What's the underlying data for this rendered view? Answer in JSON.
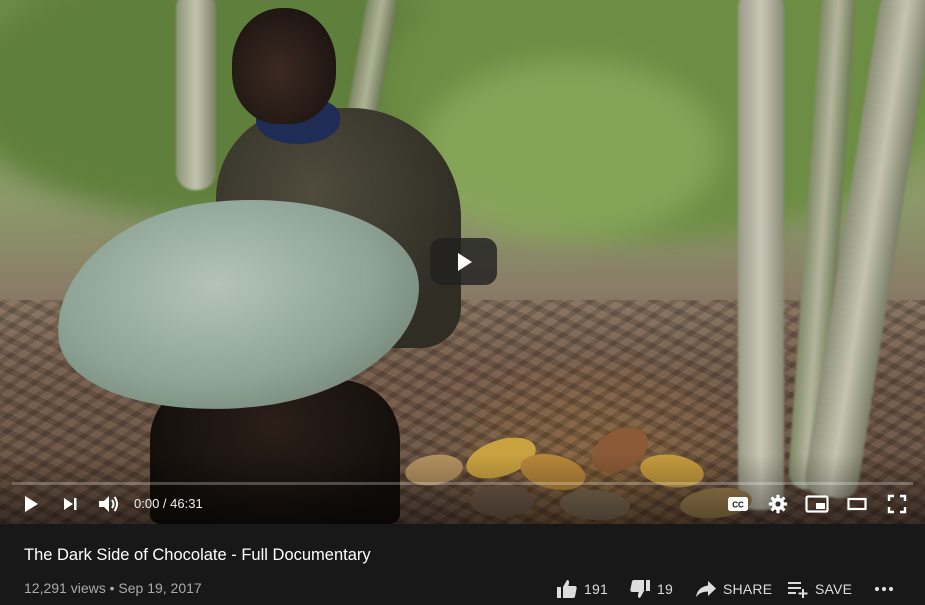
{
  "player": {
    "current_time": "0:00",
    "duration": "46:31",
    "time_separator": " / ",
    "progress_fraction": 0.0
  },
  "video": {
    "title": "The Dark Side of Chocolate - Full Documentary",
    "views": "12,291 views",
    "meta_separator": " • ",
    "date": "Sep 19, 2017"
  },
  "actions": {
    "like_count": "191",
    "dislike_count": "19",
    "share_label": "SHARE",
    "save_label": "SAVE"
  },
  "icons": {
    "big_play": "play-icon",
    "play": "play-icon",
    "next": "next-icon",
    "volume": "volume-icon",
    "captions": "captions-icon",
    "settings": "gear-icon",
    "miniplayer": "miniplayer-icon",
    "theater": "theater-icon",
    "fullscreen": "fullscreen-icon",
    "like": "thumbs-up-icon",
    "dislike": "thumbs-down-icon",
    "share": "share-icon",
    "save": "playlist-add-icon",
    "more": "more-icon"
  },
  "colors": {
    "progress": "#ff0000",
    "background": "#181818",
    "meta_text": "#aaaaaa"
  }
}
